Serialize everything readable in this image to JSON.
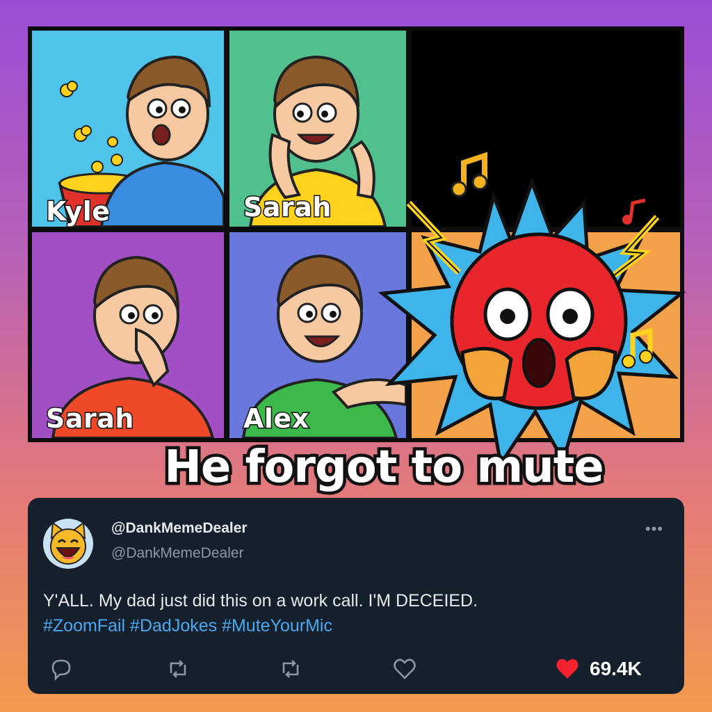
{
  "participants": [
    {
      "name": "Kyle"
    },
    {
      "name": "Sarah"
    },
    {
      "name": "Sarah"
    },
    {
      "name": "Alex"
    }
  ],
  "caption": "He forgot to mute",
  "post": {
    "display_name": "@DankMemeDealer",
    "handle": "@DankMemeDealer",
    "more_label": "•••",
    "text": "Y'ALL. My dad just did this on a work call. I'M DECEIED.",
    "hashtags": [
      "#ZoomFail",
      "#DadJokes",
      "#MuteYourMic"
    ],
    "like_count": "69.4K",
    "actions": [
      "reply-icon",
      "retweet-icon",
      "retweet-icon",
      "like-icon",
      "liked-heart-icon"
    ]
  },
  "colors": {
    "card_bg": "#16202d",
    "hashtag": "#4aa8f0",
    "heart": "#f4212e"
  }
}
